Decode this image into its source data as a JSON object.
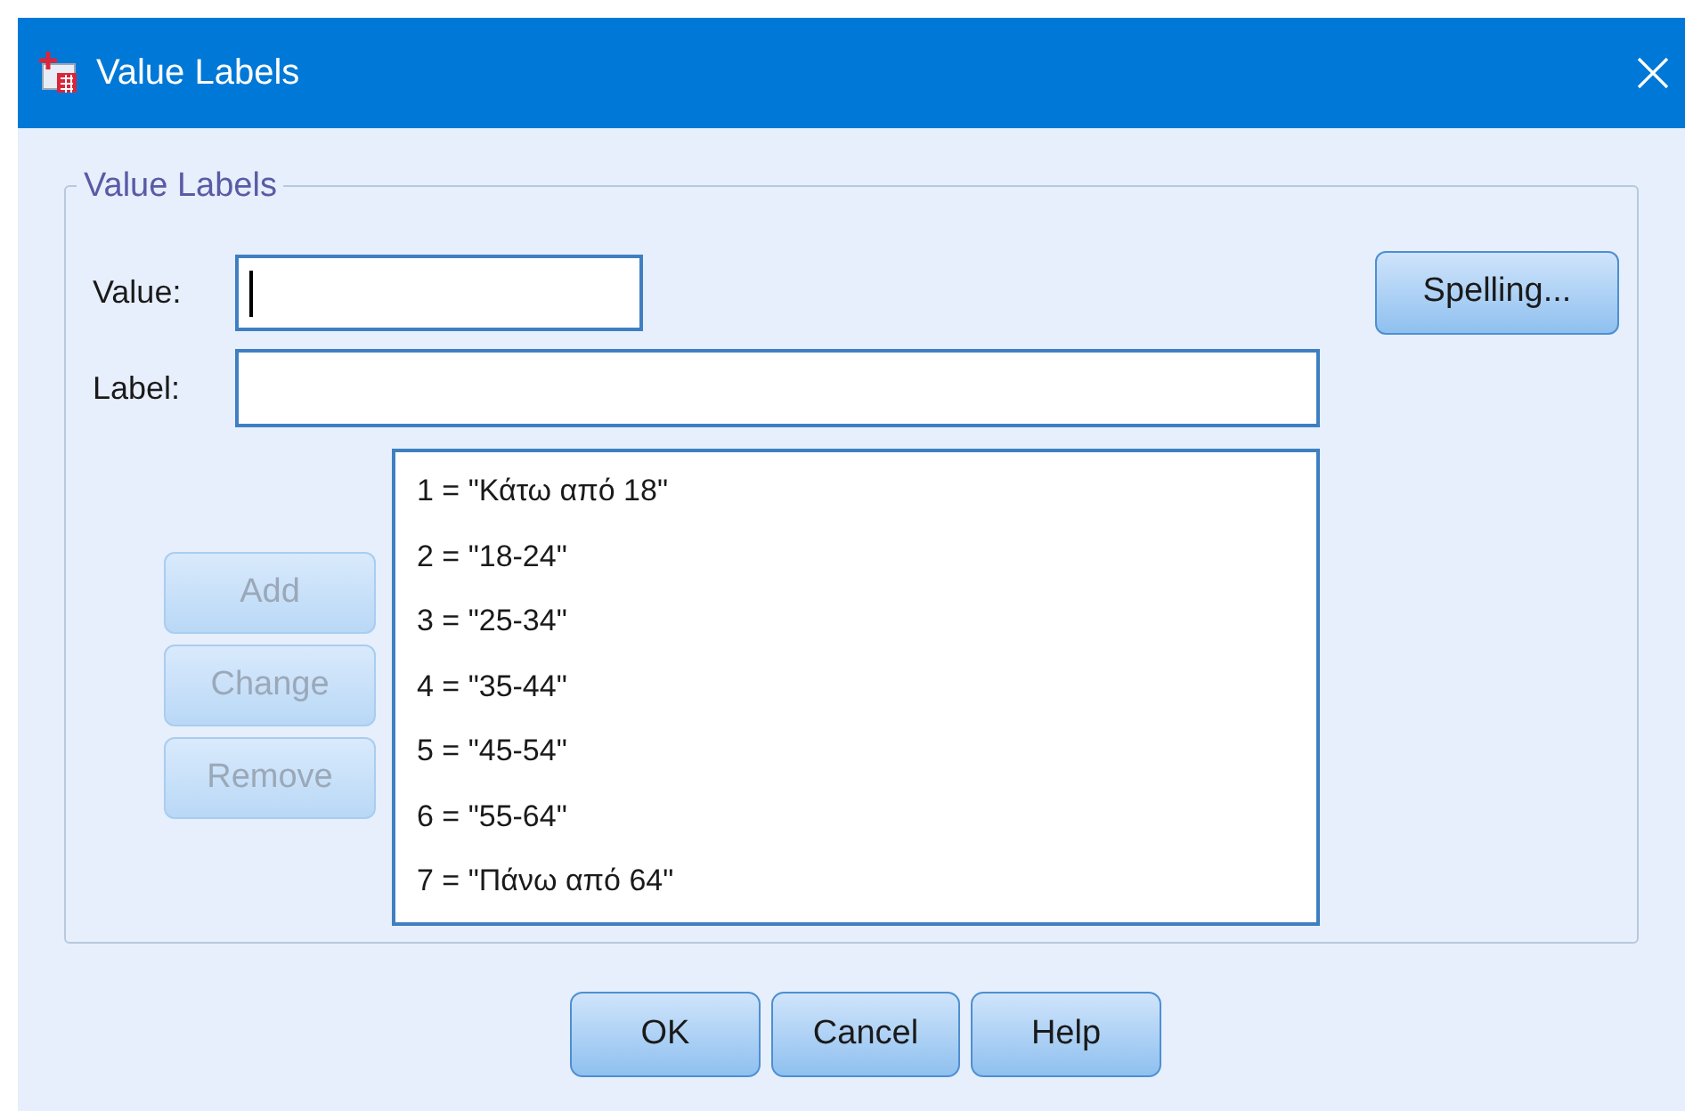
{
  "window": {
    "title": "Value Labels"
  },
  "group": {
    "title": "Value Labels"
  },
  "value_field": {
    "label": "Value:",
    "focused": true
  },
  "label_field": {
    "label": "Label:"
  },
  "spelling_button": {
    "label": "Spelling...",
    "disabled": false
  },
  "side_buttons": [
    {
      "label": "Add",
      "disabled": true
    },
    {
      "label": "Change",
      "disabled": true
    },
    {
      "label": "Remove",
      "disabled": true
    }
  ],
  "list_items": [
    {
      "text": "1 = \"Κάτω από 18\"",
      "selected": false
    },
    {
      "text": "2 = \"18-24\"",
      "selected": false
    },
    {
      "text": "3 = \"25-34\"",
      "selected": false
    },
    {
      "text": "4 = \"35-44\"",
      "selected": false
    },
    {
      "text": "5 = \"45-54\"",
      "selected": false
    },
    {
      "text": "6 = \"55-64\"",
      "selected": false
    },
    {
      "text": "7 = \"Πάνω από 64\"",
      "selected": false
    }
  ],
  "buttons": [
    {
      "label": "OK",
      "disabled": false
    },
    {
      "label": "Cancel",
      "disabled": false
    },
    {
      "label": "Help",
      "disabled": false
    }
  ]
}
